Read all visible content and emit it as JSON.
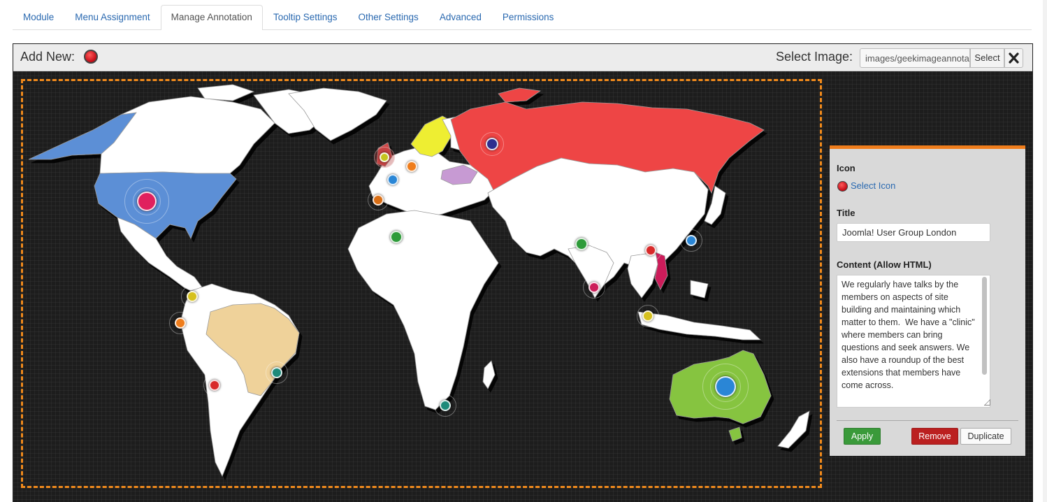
{
  "tabs": [
    {
      "label": "Module",
      "active": false
    },
    {
      "label": "Menu Assignment",
      "active": false
    },
    {
      "label": "Manage Annotation",
      "active": true
    },
    {
      "label": "Tooltip Settings",
      "active": false
    },
    {
      "label": "Other Settings",
      "active": false
    },
    {
      "label": "Advanced",
      "active": false
    },
    {
      "label": "Permissions",
      "active": false
    }
  ],
  "toolbar": {
    "add_new_label": "Add New:",
    "add_new_icon": "red-pin-icon",
    "select_image_label": "Select Image:",
    "image_path": "images/geekimageannotation/world-map.png",
    "select_button": "Select",
    "clear_icon": "close-icon"
  },
  "colors": {
    "accent_border": "#f08a1c",
    "usa": "#5b8fd6",
    "russia": "#ee4444",
    "brazil": "#efd29a",
    "australia": "#86c440",
    "land": "#ffffff",
    "background": "#1d1d1d",
    "apply": "#3a9a3a",
    "remove": "#bb2020"
  },
  "panel": {
    "icon_label": "Icon",
    "select_icon_link": "Select Icon",
    "title_label": "Title",
    "title_value": "Joomla! User Group London",
    "content_label": "Content (Allow HTML)",
    "content_value": "We regularly have talks by the members on aspects of site building and maintaining which matter to them.  We have a \"clinic\" where members can bring questions and seek answers. We also have a roundup of the best extensions that members have come across.",
    "apply_button": "Apply",
    "remove_button": "Remove",
    "duplicate_button": "Duplicate"
  }
}
